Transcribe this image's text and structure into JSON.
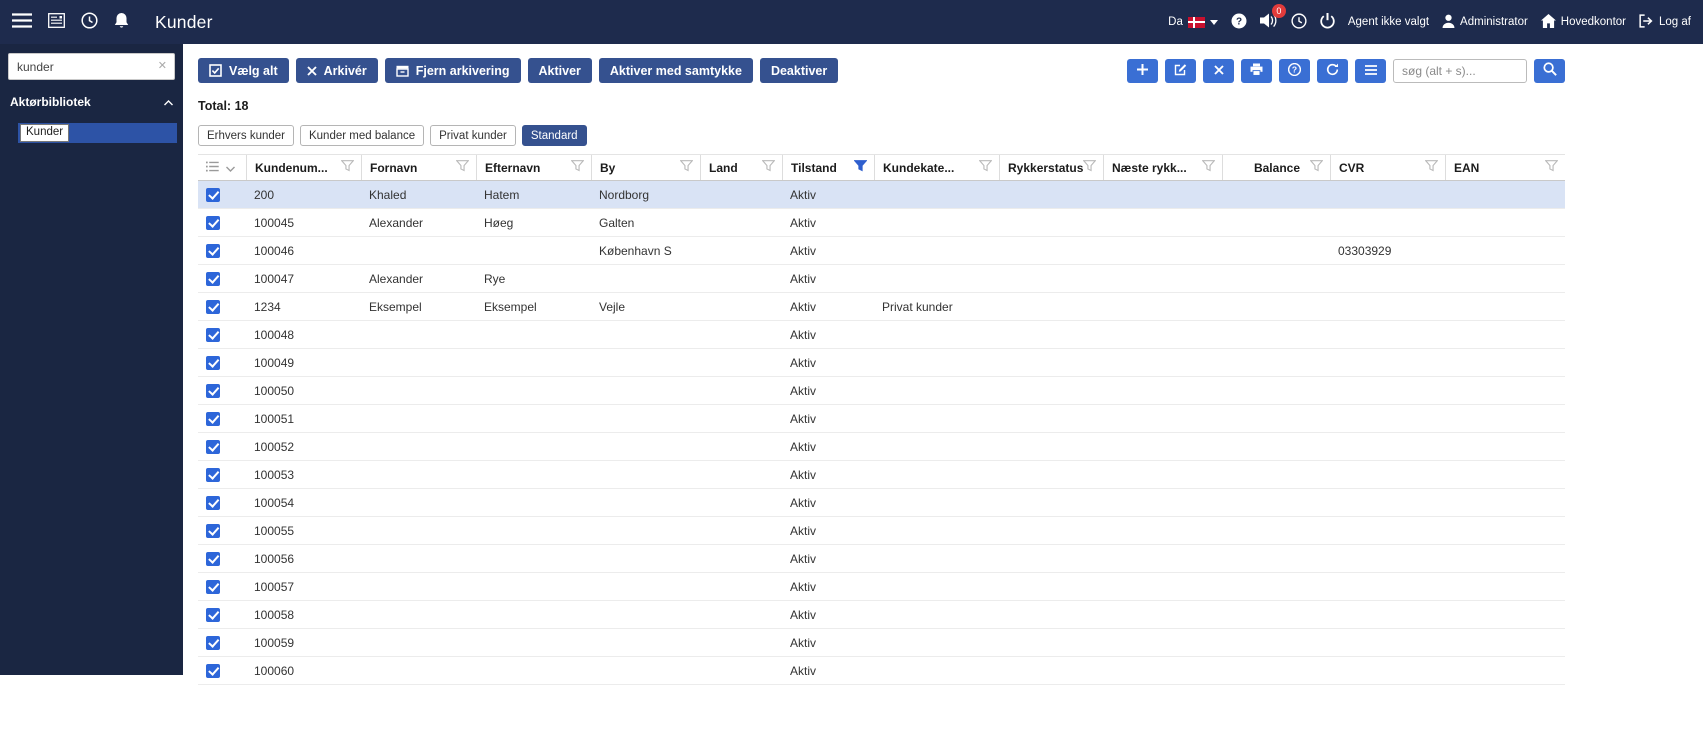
{
  "topbar": {
    "title": "Kunder",
    "language": "Da",
    "notification_badge": "0",
    "agent_label": "Agent ikke valgt",
    "user_label": "Administrator",
    "office_label": "Hovedkontor",
    "logout_label": "Log af"
  },
  "sidebar": {
    "search_value": "kunder",
    "section_title": "Aktørbibliotek",
    "items": [
      {
        "label": "Kunder",
        "selected": true
      }
    ]
  },
  "toolbar": {
    "buttons": [
      {
        "name": "select-all-button",
        "label": "Vælg alt",
        "icon": "select-all"
      },
      {
        "name": "archive-button",
        "label": "Arkivér",
        "icon": "x"
      },
      {
        "name": "unarchive-button",
        "label": "Fjern arkivering",
        "icon": "unarchive"
      },
      {
        "name": "activate-button",
        "label": "Aktiver",
        "icon": ""
      },
      {
        "name": "activate-consent-button",
        "label": "Aktiver med samtykke",
        "icon": ""
      },
      {
        "name": "deactivate-button",
        "label": "Deaktiver",
        "icon": ""
      }
    ],
    "icon_buttons": [
      {
        "name": "add-button",
        "icon": "plus"
      },
      {
        "name": "edit-button",
        "icon": "edit"
      },
      {
        "name": "delete-button",
        "icon": "x"
      },
      {
        "name": "print-button",
        "icon": "print"
      },
      {
        "name": "help-button",
        "icon": "help"
      },
      {
        "name": "refresh-button",
        "icon": "refresh"
      },
      {
        "name": "columns-button",
        "icon": "menu"
      }
    ],
    "search_placeholder": "søg (alt + s)..."
  },
  "summary": {
    "total_label": "Total: 18"
  },
  "filter_chips": [
    {
      "name": "chip-erhvers-kunder",
      "label": "Erhvers kunder",
      "active": false
    },
    {
      "name": "chip-kunder-med-balance",
      "label": "Kunder med balance",
      "active": false
    },
    {
      "name": "chip-privat-kunder",
      "label": "Privat kunder",
      "active": false
    },
    {
      "name": "chip-standard",
      "label": "Standard",
      "active": true
    }
  ],
  "table": {
    "columns": [
      {
        "key": "kundenummer",
        "label": "Kundenum...",
        "filter_active": false
      },
      {
        "key": "fornavn",
        "label": "Fornavn",
        "filter_active": false
      },
      {
        "key": "efternavn",
        "label": "Efternavn",
        "filter_active": false
      },
      {
        "key": "by",
        "label": "By",
        "filter_active": false
      },
      {
        "key": "land",
        "label": "Land",
        "filter_active": false
      },
      {
        "key": "tilstand",
        "label": "Tilstand",
        "filter_active": true
      },
      {
        "key": "kundekategori",
        "label": "Kundekate...",
        "filter_active": false
      },
      {
        "key": "rykkerstatus",
        "label": "Rykkerstatus",
        "filter_active": false
      },
      {
        "key": "naeste_rykker",
        "label": "Næste rykk...",
        "filter_active": false
      },
      {
        "key": "balance",
        "label": "Balance",
        "filter_active": false,
        "align": "right"
      },
      {
        "key": "cvr",
        "label": "CVR",
        "filter_active": false
      },
      {
        "key": "ean",
        "label": "EAN",
        "filter_active": false
      }
    ],
    "rows": [
      {
        "selected": true,
        "checked": true,
        "cells": [
          "200",
          "Khaled",
          "Hatem",
          "Nordborg",
          "",
          "Aktiv",
          "",
          "",
          "",
          "",
          "",
          ""
        ]
      },
      {
        "selected": false,
        "checked": true,
        "cells": [
          "100045",
          "Alexander",
          "Høeg",
          "Galten",
          "",
          "Aktiv",
          "",
          "",
          "",
          "",
          "",
          ""
        ]
      },
      {
        "selected": false,
        "checked": true,
        "cells": [
          "100046",
          "",
          "",
          "København S",
          "",
          "Aktiv",
          "",
          "",
          "",
          "",
          "03303929",
          ""
        ]
      },
      {
        "selected": false,
        "checked": true,
        "cells": [
          "100047",
          "Alexander",
          "Rye",
          "",
          "",
          "Aktiv",
          "",
          "",
          "",
          "",
          "",
          ""
        ]
      },
      {
        "selected": false,
        "checked": true,
        "cells": [
          "1234",
          "Eksempel",
          "Eksempel",
          "Vejle",
          "",
          "Aktiv",
          "Privat kunder",
          "",
          "",
          "",
          "",
          ""
        ]
      },
      {
        "selected": false,
        "checked": true,
        "cells": [
          "100048",
          "",
          "",
          "",
          "",
          "Aktiv",
          "",
          "",
          "",
          "",
          "",
          ""
        ]
      },
      {
        "selected": false,
        "checked": true,
        "cells": [
          "100049",
          "",
          "",
          "",
          "",
          "Aktiv",
          "",
          "",
          "",
          "",
          "",
          ""
        ]
      },
      {
        "selected": false,
        "checked": true,
        "cells": [
          "100050",
          "",
          "",
          "",
          "",
          "Aktiv",
          "",
          "",
          "",
          "",
          "",
          ""
        ]
      },
      {
        "selected": false,
        "checked": true,
        "cells": [
          "100051",
          "",
          "",
          "",
          "",
          "Aktiv",
          "",
          "",
          "",
          "",
          "",
          ""
        ]
      },
      {
        "selected": false,
        "checked": true,
        "cells": [
          "100052",
          "",
          "",
          "",
          "",
          "Aktiv",
          "",
          "",
          "",
          "",
          "",
          ""
        ]
      },
      {
        "selected": false,
        "checked": true,
        "cells": [
          "100053",
          "",
          "",
          "",
          "",
          "Aktiv",
          "",
          "",
          "",
          "",
          "",
          ""
        ]
      },
      {
        "selected": false,
        "checked": true,
        "cells": [
          "100054",
          "",
          "",
          "",
          "",
          "Aktiv",
          "",
          "",
          "",
          "",
          "",
          ""
        ]
      },
      {
        "selected": false,
        "checked": true,
        "cells": [
          "100055",
          "",
          "",
          "",
          "",
          "Aktiv",
          "",
          "",
          "",
          "",
          "",
          ""
        ]
      },
      {
        "selected": false,
        "checked": true,
        "cells": [
          "100056",
          "",
          "",
          "",
          "",
          "Aktiv",
          "",
          "",
          "",
          "",
          "",
          ""
        ]
      },
      {
        "selected": false,
        "checked": true,
        "cells": [
          "100057",
          "",
          "",
          "",
          "",
          "Aktiv",
          "",
          "",
          "",
          "",
          "",
          ""
        ]
      },
      {
        "selected": false,
        "checked": true,
        "cells": [
          "100058",
          "",
          "",
          "",
          "",
          "Aktiv",
          "",
          "",
          "",
          "",
          "",
          ""
        ]
      },
      {
        "selected": false,
        "checked": true,
        "cells": [
          "100059",
          "",
          "",
          "",
          "",
          "Aktiv",
          "",
          "",
          "",
          "",
          "",
          ""
        ]
      },
      {
        "selected": false,
        "checked": true,
        "cells": [
          "100060",
          "",
          "",
          "",
          "",
          "Aktiv",
          "",
          "",
          "",
          "",
          "",
          ""
        ]
      }
    ]
  },
  "colors": {
    "topbar_bg": "#1e2b4d",
    "sidebar_bg": "#1a2642",
    "button_blue": "#35518f",
    "accent_blue": "#3a6fd4",
    "selected_row": "#d9e3f5",
    "checkbox_blue": "#2d66d9",
    "active_filter_blue": "#2f5fce",
    "badge_red": "#e23b3b",
    "flag_red": "#c8102e"
  }
}
